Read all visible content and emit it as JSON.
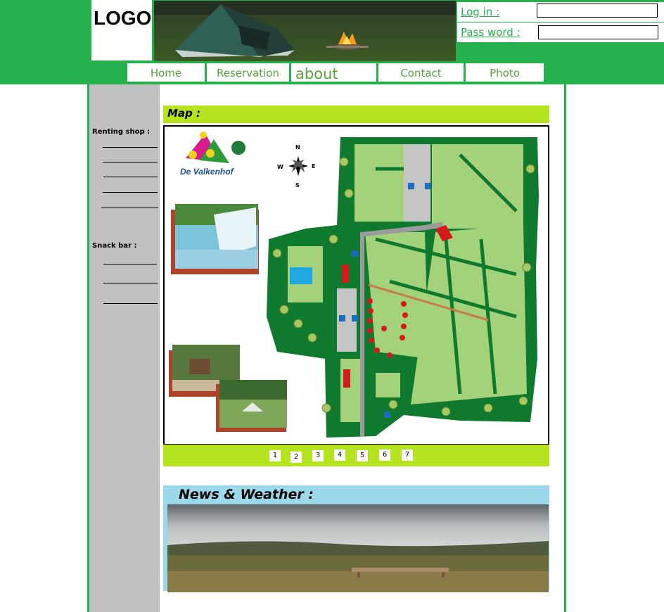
{
  "header": {
    "logo_text": "LOGO",
    "login_label": "Log in :",
    "login_value": "",
    "password_label": "Pass word :",
    "password_value": ""
  },
  "nav": {
    "items": [
      {
        "label": "Home"
      },
      {
        "label": "Reservation"
      },
      {
        "label": "about"
      },
      {
        "label": "Contact"
      },
      {
        "label": "Photo"
      }
    ]
  },
  "sidebar": {
    "renting_heading": "Renting shop :",
    "snack_heading": "Snack bar :"
  },
  "map_section": {
    "title": "Map :",
    "logo_text": "De Valkenhof",
    "compass": {
      "n": "N",
      "s": "S",
      "e": "E",
      "w": "W"
    },
    "pages": [
      "1",
      "2",
      "3",
      "4",
      "5",
      "6",
      "7"
    ]
  },
  "news_section": {
    "title": "News & Weather :"
  },
  "colors": {
    "brand_green": "#24b14b",
    "lime": "#b5e41e",
    "sky": "#9bd8ea",
    "sidebar_gray": "#c0c0c0",
    "nav_text": "#56a33d"
  }
}
